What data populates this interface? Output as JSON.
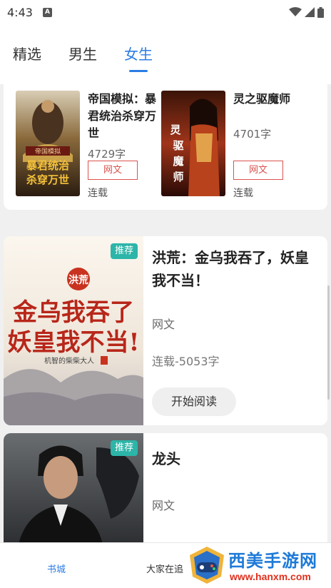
{
  "status_bar": {
    "time": "4:43",
    "notif_letter": "A"
  },
  "tabs": [
    {
      "label": "精选"
    },
    {
      "label": "男生"
    },
    {
      "label": "女生"
    }
  ],
  "grid_books": [
    {
      "title": "帝国模拟：暴君统治杀穿万世",
      "count": "4729字",
      "tag": "网文",
      "status": "连载",
      "cover_text": "帝国模拟",
      "cover_big_text": "暴君统治杀穿万世"
    },
    {
      "title": "灵之驱魔师",
      "count": "4701字",
      "tag": "网文",
      "status": "连载",
      "cover_text": "灵之驱魔师"
    }
  ],
  "featured": [
    {
      "badge": "推荐",
      "title": "洪荒：金乌我吞了，妖皇我不当！",
      "tag": "网文",
      "status": "连载-5053字",
      "button": "开始阅读",
      "cover_seal": "洪荒",
      "cover_line1": "金乌我吞了",
      "cover_line2": "妖皇我不当!",
      "cover_author": "机智的柴柴大人"
    },
    {
      "badge": "推荐",
      "title": "龙头",
      "tag": "网文"
    }
  ],
  "bottom_nav": [
    {
      "label": "书城"
    },
    {
      "label": "大家在追"
    }
  ],
  "watermark": {
    "title": "西美手游网",
    "url": "www.hanxm.com"
  },
  "colors": {
    "accent": "#2b7de3",
    "tag_red": "#d9534f",
    "badge_teal": "#2cb5a8"
  }
}
